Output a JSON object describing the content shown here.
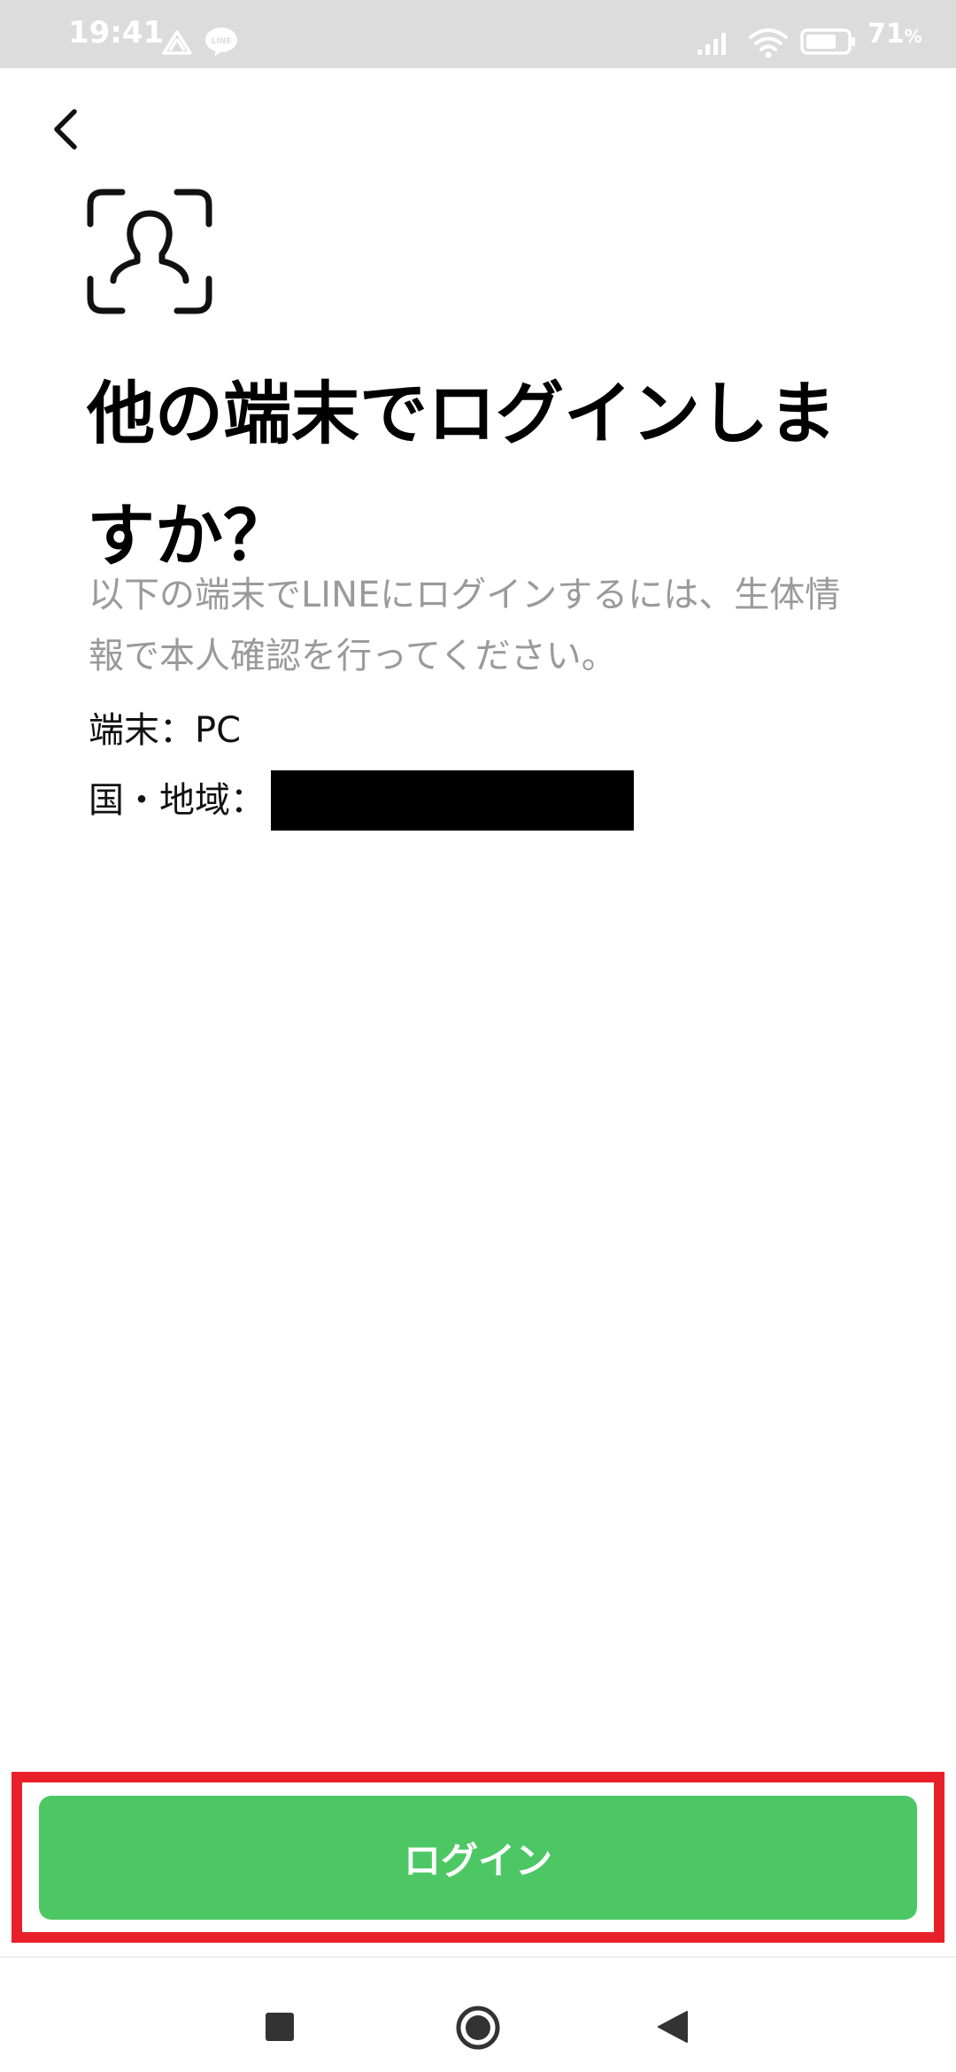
{
  "status_bar": {
    "time": "19:41",
    "battery_percent": "71",
    "battery_unit": "%",
    "icons": [
      "drive-icon",
      "line-app-icon",
      "signal-icon",
      "wifi-icon",
      "battery-icon"
    ]
  },
  "header": {
    "back_icon": "chevron-left-icon"
  },
  "main": {
    "icon": "face-scan-icon",
    "title": "他の端末でログインしま\nすか？",
    "description": "以下の端末でLINEにログインするには、生体情\n報で本人確認を行ってください。",
    "device_label": "端末：",
    "device_value": "PC",
    "region_label": "国・地域："
  },
  "footer": {
    "login_label": "ログイン"
  },
  "nav_bar": {
    "icons": [
      "recents-icon",
      "home-icon",
      "back-icon"
    ]
  },
  "colors": {
    "accent_green": "#4cc764",
    "highlight_red": "#e8202a",
    "status_bar_bg": "#dcdcdc",
    "description_gray": "#9a9a9a"
  }
}
